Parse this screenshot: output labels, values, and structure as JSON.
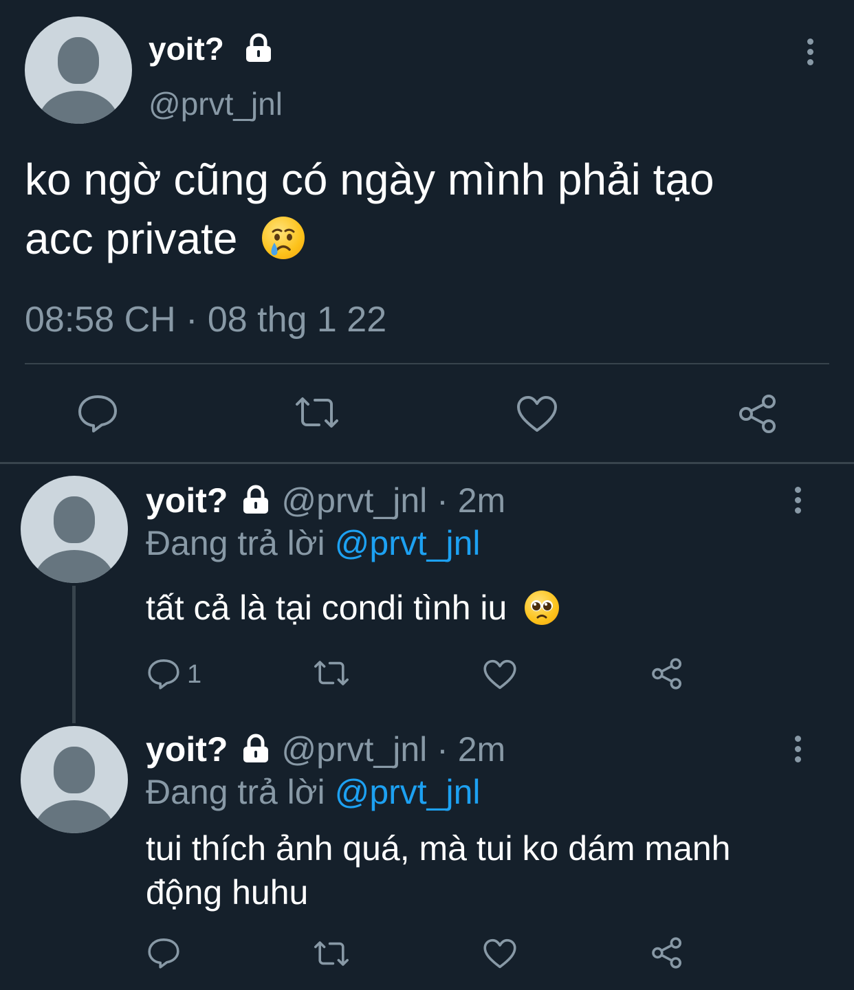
{
  "main_tweet": {
    "display_name": "yoit?",
    "handle": "@prvt_jnl",
    "text_line1": "ko ngờ cũng có ngày mình phải tạo",
    "text_line2": "acc private",
    "emoji": "crying-face",
    "timestamp": "08:58 CH · 08 thg 1 22",
    "actions": [
      "reply-icon",
      "retweet-icon",
      "like-icon",
      "share-icon"
    ]
  },
  "replies": [
    {
      "display_name": "yoit?",
      "handle_time": "@prvt_jnl · 2m",
      "replying_prefix": "Đang trả lời ",
      "replying_to": "@prvt_jnl",
      "text_line1": "tất cả là tại condi tình iu",
      "text_line2": "",
      "emoji": "pleading-face",
      "reply_count": "1"
    },
    {
      "display_name": "yoit?",
      "handle_time": "@prvt_jnl · 2m",
      "replying_prefix": "Đang trả lời ",
      "replying_to": "@prvt_jnl",
      "text_line1": "tui thích ảnh quá, mà tui ko dám manh",
      "text_line2": "động huhu",
      "emoji": "",
      "reply_count": ""
    }
  ],
  "colors": {
    "background": "#15202b",
    "text": "#ffffff",
    "muted": "#8899a6",
    "link": "#1da1f2",
    "divider": "#38444d"
  }
}
